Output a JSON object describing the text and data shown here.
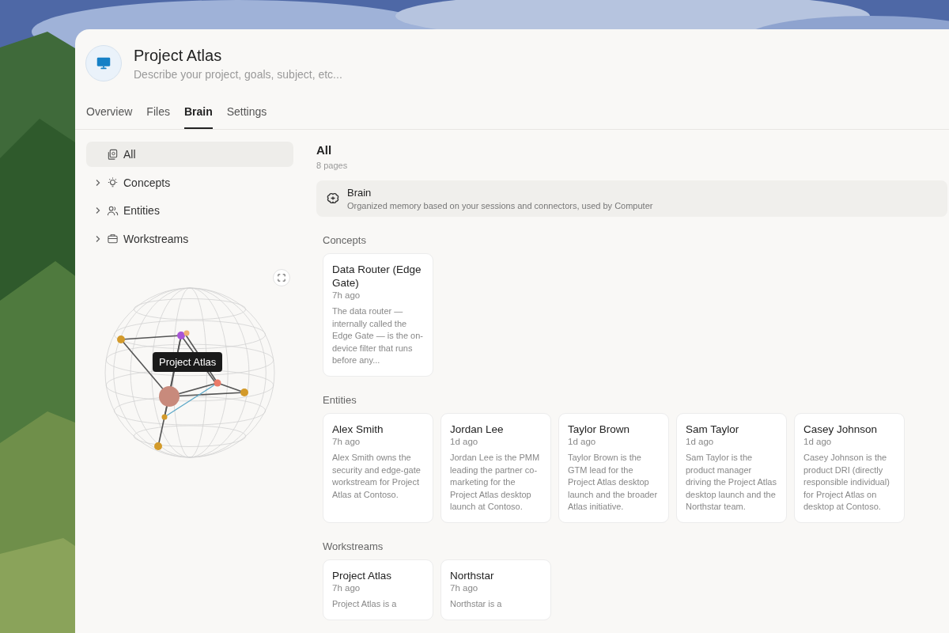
{
  "project": {
    "title": "Project Atlas",
    "placeholder": "Describe your project, goals, subject, etc..."
  },
  "tabs": [
    {
      "label": "Overview",
      "selected": false
    },
    {
      "label": "Files",
      "selected": false
    },
    {
      "label": "Brain",
      "selected": true
    },
    {
      "label": "Settings",
      "selected": false
    }
  ],
  "sidebar": {
    "items": [
      {
        "label": "All",
        "kind": "pages",
        "selected": true
      },
      {
        "label": "Concepts",
        "kind": "idea",
        "selected": false,
        "expanded": false
      },
      {
        "label": "Entities",
        "kind": "people",
        "selected": false,
        "expanded": false
      },
      {
        "label": "Workstreams",
        "kind": "case",
        "selected": false,
        "expanded": false
      }
    ]
  },
  "graph": {
    "tooltip": "Project Atlas"
  },
  "main": {
    "title": "All",
    "count": "8 pages",
    "banner": {
      "title": "Brain",
      "text": "Organized memory based on your sessions and connectors, used by Computer"
    },
    "sections": [
      {
        "heading": "Concepts",
        "cards": [
          {
            "title": "Data Router (Edge Gate)",
            "time": "7h ago",
            "text": "The data router — internally called the Edge Gate — is the on-device filter that runs before any..."
          }
        ]
      },
      {
        "heading": "Entities",
        "cards": [
          {
            "title": "Alex Smith",
            "time": "7h ago",
            "text": "Alex Smith owns the security and edge-gate workstream for Project Atlas at Contoso."
          },
          {
            "title": "Jordan Lee",
            "time": "1d ago",
            "text": "Jordan Lee is the PMM leading the partner co-marketing for the Project Atlas desktop launch at Contoso."
          },
          {
            "title": "Taylor Brown",
            "time": "1d ago",
            "text": "Taylor Brown is the GTM lead for the Project Atlas desktop launch and the broader Atlas initiative."
          },
          {
            "title": "Sam Taylor",
            "time": "1d ago",
            "text": "Sam Taylor is the product manager driving the Project Atlas desktop launch and the Northstar team."
          },
          {
            "title": "Casey Johnson",
            "time": "1d ago",
            "text": "Casey Johnson is the product DRI (directly responsible individual) for Project Atlas on desktop at Contoso."
          }
        ]
      },
      {
        "heading": "Workstreams",
        "cards": [
          {
            "title": "Project Atlas",
            "time": "7h ago",
            "text": "Project Atlas is a"
          },
          {
            "title": "Northstar",
            "time": "7h ago",
            "text": "Northstar is a"
          }
        ]
      }
    ]
  }
}
